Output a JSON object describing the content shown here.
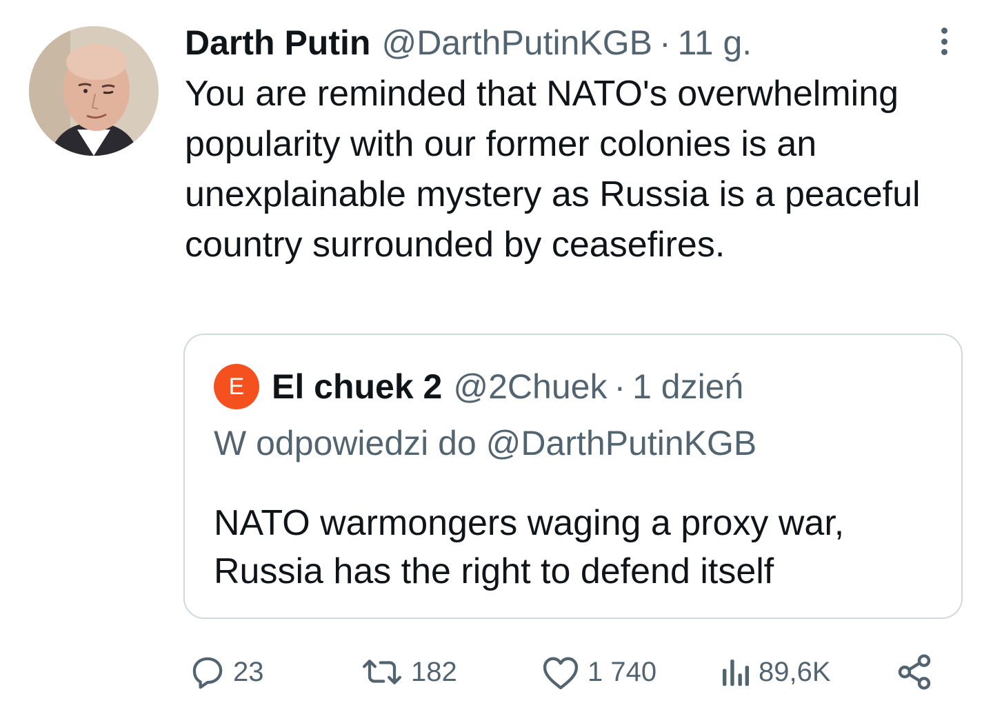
{
  "tweet": {
    "author_name": "Darth Putin",
    "author_handle": "@DarthPutinKGB",
    "separator": "·",
    "time": "11 g.",
    "text": "You are reminded that NATO's overwhelming popularity with our former colonies is an unexplainable mystery as Russia is a peaceful country surrounded by ceasefires.",
    "more_icon": "more-vertical-icon"
  },
  "quote": {
    "avatar_letter": "E",
    "avatar_color": "#f4511e",
    "author_name": "El chuek 2",
    "author_handle": "@2Chuek",
    "separator": "·",
    "time": "1 dzień",
    "reply_label": "W odpowiedzi do",
    "reply_handle": "@DarthPutinKGB",
    "text": "NATO warmongers waging a proxy war, Russia has the right to defend itself"
  },
  "actions": {
    "reply": {
      "icon": "reply-icon",
      "count": "23"
    },
    "retweet": {
      "icon": "retweet-icon",
      "count": "182"
    },
    "like": {
      "icon": "heart-icon",
      "count": "1 740"
    },
    "views": {
      "icon": "views-icon",
      "count": "89,6K"
    },
    "share": {
      "icon": "share-icon"
    }
  },
  "colors": {
    "text_primary": "#0f1419",
    "text_secondary": "#536471",
    "border": "#cfd9de"
  }
}
